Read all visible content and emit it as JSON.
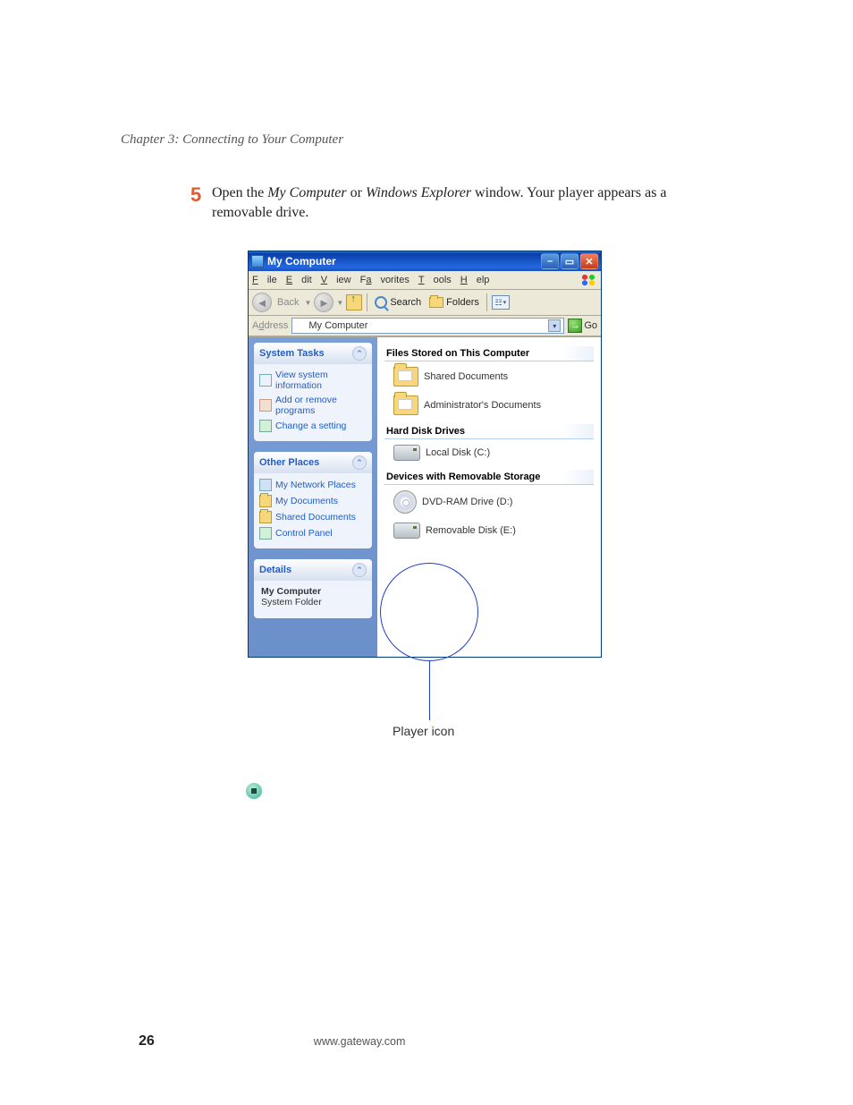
{
  "chapter_heading": "Chapter 3: Connecting to Your Computer",
  "step": {
    "number": "5",
    "prefix": "Open the ",
    "em1": "My Computer",
    "mid": " or ",
    "em2": "Windows Explorer",
    "suffix": " window. Your player appears as a removable drive."
  },
  "window": {
    "title": "My Computer",
    "menus": {
      "file": "File",
      "edit": "Edit",
      "view": "View",
      "favorites": "Favorites",
      "tools": "Tools",
      "help": "Help"
    },
    "toolbar": {
      "back": "Back",
      "search": "Search",
      "folders": "Folders"
    },
    "address": {
      "label": "Address",
      "value": "My Computer",
      "go": "Go"
    },
    "sidebar": {
      "system_tasks": {
        "title": "System Tasks",
        "items": [
          "View system information",
          "Add or remove programs",
          "Change a setting"
        ]
      },
      "other_places": {
        "title": "Other Places",
        "items": [
          "My Network Places",
          "My Documents",
          "Shared Documents",
          "Control Panel"
        ]
      },
      "details": {
        "title": "Details",
        "name": "My Computer",
        "type": "System Folder"
      }
    },
    "groups": {
      "files_stored": {
        "title": "Files Stored on This Computer",
        "items": [
          "Shared Documents",
          "Administrator's Documents"
        ]
      },
      "hard_disk": {
        "title": "Hard Disk Drives",
        "items": [
          "Local Disk (C:)"
        ]
      },
      "removable": {
        "title": "Devices with Removable Storage",
        "items": [
          "DVD-RAM Drive (D:)",
          "Removable Disk (E:)"
        ]
      }
    }
  },
  "callout_label": "Player icon",
  "footer": {
    "page": "26",
    "url": "www.gateway.com"
  }
}
